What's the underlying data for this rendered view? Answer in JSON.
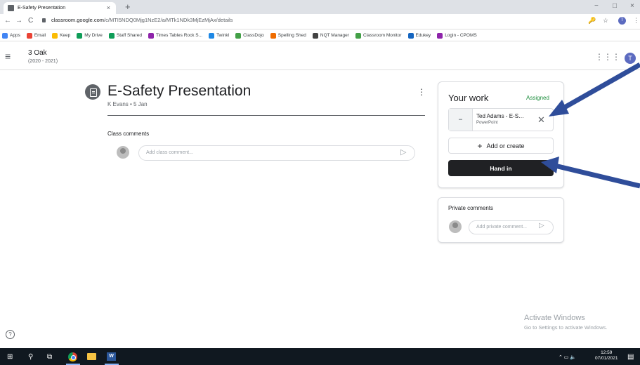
{
  "browser": {
    "tab_title": "E-Safety Presentation",
    "tab_close": "×",
    "new_tab": "+",
    "url_main": "classroom.google.com",
    "url_path": "/c/MTI5NDQ0Mjg1NzE2/a/MTk1NDk3MjEzMjAx/details",
    "back": "←",
    "forward": "→",
    "reload": "C",
    "minimize": "−",
    "maximize": "□",
    "close": "×",
    "key_icon": "🔑",
    "star_icon": "☆",
    "more": "⋮",
    "profile_initial": "T"
  },
  "bookmarks": [
    {
      "label": "Apps",
      "color": "#4285f4"
    },
    {
      "label": "Email",
      "color": "#ea4335"
    },
    {
      "label": "Keep",
      "color": "#fbbc04"
    },
    {
      "label": "My Drive",
      "color": "#0f9d58"
    },
    {
      "label": "Staff Shared",
      "color": "#0f9d58"
    },
    {
      "label": "Times Tables Rock S...",
      "color": "#8e24aa"
    },
    {
      "label": "Twinkl",
      "color": "#1e88e5"
    },
    {
      "label": "ClassDojo",
      "color": "#43a047"
    },
    {
      "label": "Spelling Shed",
      "color": "#ef6c00"
    },
    {
      "label": "NQT Manager",
      "color": "#424242"
    },
    {
      "label": "Classroom Monitor",
      "color": "#43a047"
    },
    {
      "label": "Edukey",
      "color": "#1565c0"
    },
    {
      "label": "Login - CPOMS",
      "color": "#8e24aa"
    }
  ],
  "classroom": {
    "menu_icon": "≡",
    "class_name": "3 Oak",
    "class_year": "(2020 - 2021)",
    "apps_icon": "⋮⋮⋮",
    "avatar_initial": "T"
  },
  "assignment": {
    "title": "E-Safety Presentation",
    "meta": "K Evans • 5 Jan",
    "more_icon": "⋮",
    "class_comments_label": "Class comments",
    "class_comment_placeholder": "Add class comment...",
    "send_icon": "▷"
  },
  "your_work": {
    "title": "Your work",
    "status": "Assigned",
    "attachment_name": "Ted Adams - E-Safety Presentation",
    "attachment_type": "PowerPoint",
    "attachment_thumb": "▬",
    "remove_icon": "✕",
    "add_or_create": "Add or create",
    "plus": "+",
    "hand_in": "Hand in"
  },
  "private_comments": {
    "title": "Private comments",
    "placeholder": "Add private comment...",
    "send_icon": "▷"
  },
  "watermark": {
    "line1": "Activate Windows",
    "line2": "Go to Settings to activate Windows."
  },
  "help_icon": "?",
  "taskbar": {
    "start": "⊞",
    "search": "⚲",
    "taskview": "⧉",
    "word": "W",
    "tray": "⌃ ▭ 🔈",
    "time": "12:59",
    "date": "07/01/2021",
    "notify": "▤"
  },
  "colors": {
    "accent_green": "#1e8e3e",
    "arrow_blue": "#2f4d9a",
    "hand_in_bg": "#202124"
  }
}
